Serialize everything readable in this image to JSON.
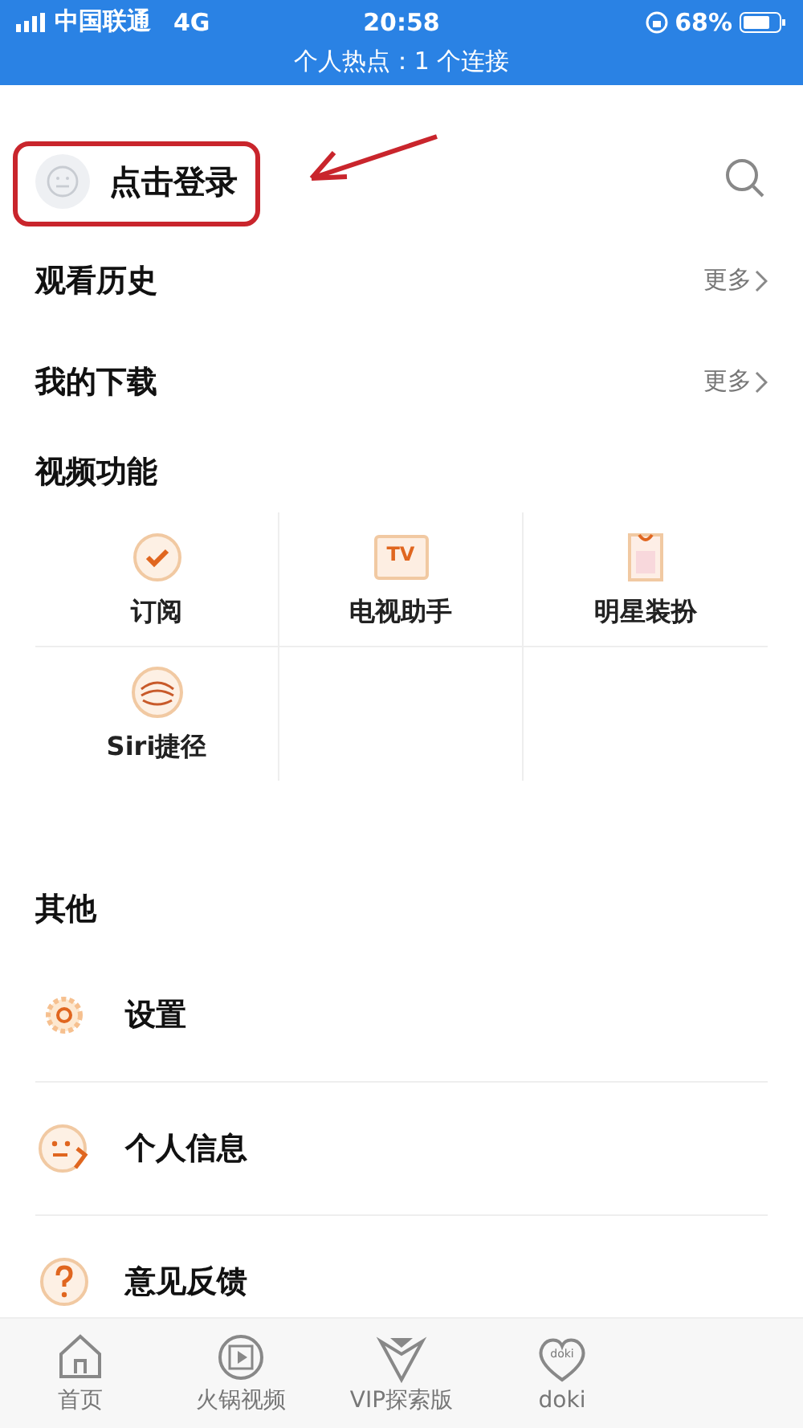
{
  "status_bar": {
    "carrier": "中国联通",
    "network": "4G",
    "time": "20:58",
    "battery": "68%",
    "hotspot": "个人热点：1 个连接"
  },
  "header": {
    "login": "点击登录"
  },
  "sections": [
    {
      "title": "观看历史",
      "more": "更多"
    },
    {
      "title": "我的下载",
      "more": "更多"
    }
  ],
  "features": {
    "title": "视频功能",
    "items": [
      {
        "kind": "subscribe",
        "label": "订阅"
      },
      {
        "kind": "tv",
        "label": "电视助手",
        "icon_text": "TV"
      },
      {
        "kind": "outfit",
        "label": "明星装扮"
      },
      {
        "kind": "siri",
        "label": "Siri捷径"
      }
    ]
  },
  "other": {
    "title": "其他",
    "items": [
      {
        "kind": "settings",
        "label": "设置"
      },
      {
        "kind": "profile",
        "label": "个人信息"
      },
      {
        "kind": "feedback",
        "label": "意见反馈"
      }
    ]
  },
  "tab_bar": [
    {
      "kind": "home",
      "label": "首页",
      "selected": false
    },
    {
      "kind": "hotpot",
      "label": "火锅视频",
      "selected": false
    },
    {
      "kind": "vip",
      "label": "VIP探索版",
      "selected": false
    },
    {
      "kind": "doki",
      "label": "doki",
      "selected": false,
      "icon_text": "doki"
    }
  ]
}
